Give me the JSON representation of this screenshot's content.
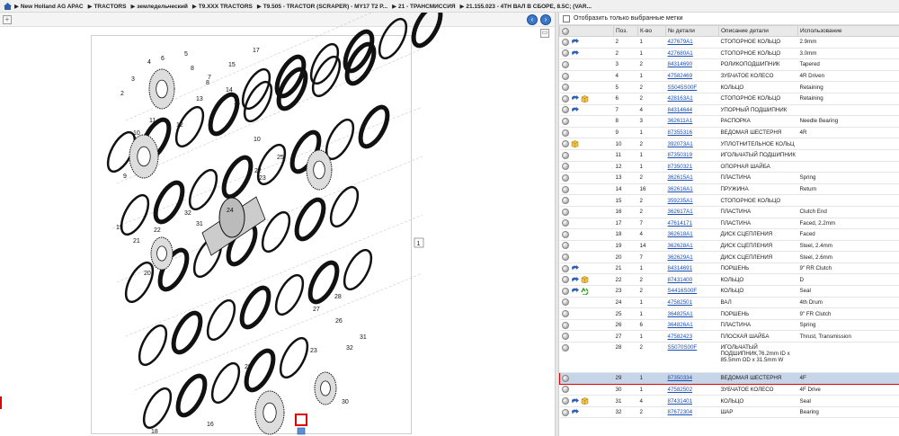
{
  "breadcrumb": [
    "New Holland AG APAC",
    "TRACTORS",
    "земледельческий",
    "T9.XXX TRACTORS",
    "T9.505 - TRACTOR (SCRAPER) - MY17 T2 P...",
    "21 - ТРАНСМИССИЯ",
    "21.155.023 - 4TH ВАЛ В СБОРЕ, 8.5C; (VAR..."
  ],
  "filter_label": "Отобразить только выбранные метки",
  "columns": [
    "Поз.",
    "К-во",
    "№ детали",
    "Описание детали",
    "Использование"
  ],
  "rows": [
    {
      "pos": "2",
      "qty": "1",
      "part": "427679A1",
      "desc": "СТОПОРНОЕ КОЛЬЦО",
      "use": "2.9mm",
      "icons": [
        "arrow"
      ]
    },
    {
      "pos": "2",
      "qty": "1",
      "part": "427680A1",
      "desc": "СТОПОРНОЕ КОЛЬЦО",
      "use": "3.0mm",
      "icons": [
        "arrow"
      ]
    },
    {
      "pos": "3",
      "qty": "2",
      "part": "84314690",
      "desc": "РОЛИКОПОДШИПНИК",
      "use": "Tapered",
      "icons": []
    },
    {
      "pos": "4",
      "qty": "1",
      "part": "47582469",
      "desc": "ЗУБЧАТОЕ КОЛЕСО",
      "use": "4R Driven",
      "icons": []
    },
    {
      "pos": "5",
      "qty": "2",
      "part": "S5045S00F",
      "desc": "КОЛЬЦО",
      "use": "Retaining",
      "icons": []
    },
    {
      "pos": "6",
      "qty": "2",
      "part": "428163A1",
      "desc": "СТОПОРНОЕ КОЛЬЦО",
      "use": "Retaining",
      "icons": [
        "arrow",
        "pkg"
      ]
    },
    {
      "pos": "7",
      "qty": "4",
      "part": "84314644",
      "desc": "УПОРНЫЙ ПОДШИПНИК",
      "use": "",
      "icons": [
        "arrow"
      ]
    },
    {
      "pos": "8",
      "qty": "3",
      "part": "362611A1",
      "desc": "РАСПОРКА",
      "use": "Needle Bearing",
      "icons": []
    },
    {
      "pos": "9",
      "qty": "1",
      "part": "87355316",
      "desc": "ВЕДОМАЯ ШЕСТЕРНЯ",
      "use": "4R",
      "icons": []
    },
    {
      "pos": "10",
      "qty": "2",
      "part": "392073A1",
      "desc": "УПЛОТНИТЕЛЬНОЕ КОЛЬЦ",
      "use": "",
      "icons": [
        "pkg"
      ]
    },
    {
      "pos": "11",
      "qty": "1",
      "part": "87350319",
      "desc": "ИГОЛЬЧАТЫЙ ПОДШИПНИК",
      "use": "",
      "icons": []
    },
    {
      "pos": "12",
      "qty": "1",
      "part": "87350321",
      "desc": "ОПОРНАЯ ШАЙБА",
      "use": "",
      "icons": []
    },
    {
      "pos": "13",
      "qty": "2",
      "part": "362615A1",
      "desc": "ПЛАСТИНА",
      "use": "Spring",
      "icons": []
    },
    {
      "pos": "14",
      "qty": "16",
      "part": "362616A1",
      "desc": "ПРУЖИНА",
      "use": "Return",
      "icons": []
    },
    {
      "pos": "15",
      "qty": "2",
      "part": "359235A1",
      "desc": "СТОПОРНОЕ КОЛЬЦО",
      "use": "",
      "icons": []
    },
    {
      "pos": "16",
      "qty": "2",
      "part": "362617A1",
      "desc": "ПЛАСТИНА",
      "use": "Clutch End",
      "icons": []
    },
    {
      "pos": "17",
      "qty": "7",
      "part": "47614171",
      "desc": "ПЛАСТИНА",
      "use": "Faced, 2.2mm",
      "icons": []
    },
    {
      "pos": "18",
      "qty": "4",
      "part": "362618A1",
      "desc": "ДИСК СЦЕПЛЕНИЯ",
      "use": "Faced",
      "icons": []
    },
    {
      "pos": "19",
      "qty": "14",
      "part": "362628A1",
      "desc": "ДИСК СЦЕПЛЕНИЯ",
      "use": "Steel, 2.4mm",
      "icons": []
    },
    {
      "pos": "20",
      "qty": "7",
      "part": "362629A1",
      "desc": "ДИСК СЦЕПЛЕНИЯ",
      "use": "Steel, 2.6mm",
      "icons": []
    },
    {
      "pos": "21",
      "qty": "1",
      "part": "84314691",
      "desc": "ПОРШЕНЬ",
      "use": "9\" RR Clutch",
      "icons": [
        "arrow"
      ]
    },
    {
      "pos": "22",
      "qty": "2",
      "part": "87431400",
      "desc": "КОЛЬЦО",
      "use": "D",
      "icons": [
        "arrow",
        "pkg"
      ]
    },
    {
      "pos": "23",
      "qty": "2",
      "part": "S4416S00F",
      "desc": "КОЛЬЦО",
      "use": "Seal",
      "icons": [
        "arrow",
        "recycle"
      ]
    },
    {
      "pos": "24",
      "qty": "1",
      "part": "47582501",
      "desc": "ВАЛ",
      "use": "4th Drum",
      "icons": []
    },
    {
      "pos": "25",
      "qty": "1",
      "part": "364825A1",
      "desc": "ПОРШЕНЬ",
      "use": "9\" FR Clutch",
      "icons": []
    },
    {
      "pos": "26",
      "qty": "6",
      "part": "364826A1",
      "desc": "ПЛАСТИНА",
      "use": "Spring",
      "icons": []
    },
    {
      "pos": "27",
      "qty": "1",
      "part": "47582423",
      "desc": "ПЛОСКАЯ ШАЙБА",
      "use": "Thrust, Transmission",
      "icons": []
    },
    {
      "pos": "28",
      "qty": "2",
      "part": "S5070S00F",
      "desc": "ИГОЛЬЧАТЫЙ ПОДШИПНИК,76.2mm ID x 85.5mm OD x 31.5mm W",
      "use": "",
      "icons": [],
      "tall": true
    },
    {
      "pos": "29",
      "qty": "1",
      "part": "87350334",
      "desc": "ВЕДОМАЯ ШЕСТЕРНЯ",
      "use": "4F",
      "icons": [],
      "selected": true
    },
    {
      "pos": "30",
      "qty": "1",
      "part": "47582502",
      "desc": "ЗУБЧАТОЕ КОЛЕСО",
      "use": "4F Drive",
      "icons": []
    },
    {
      "pos": "31",
      "qty": "4",
      "part": "87431401",
      "desc": "КОЛЬЦО",
      "use": "Seal",
      "icons": [
        "arrow",
        "pkg"
      ]
    },
    {
      "pos": "32",
      "qty": "2",
      "part": "87672304",
      "desc": "ШАР",
      "use": "Bearing",
      "icons": [
        "arrow"
      ]
    }
  ],
  "diagram_callouts": [
    "1",
    "2",
    "3",
    "4",
    "5",
    "6",
    "7",
    "8",
    "9",
    "10",
    "11",
    "12",
    "13",
    "14",
    "15",
    "16",
    "17",
    "18",
    "19",
    "20",
    "21",
    "22",
    "23",
    "24",
    "25",
    "26",
    "27",
    "28",
    "29",
    "30",
    "31",
    "32"
  ],
  "diagram_ref": "1",
  "selected_callout": "29",
  "colors": {
    "accent": "#3a78c8",
    "selected": "#c7d5e8",
    "highlight": "#e00000",
    "link": "#1a4fb5"
  }
}
